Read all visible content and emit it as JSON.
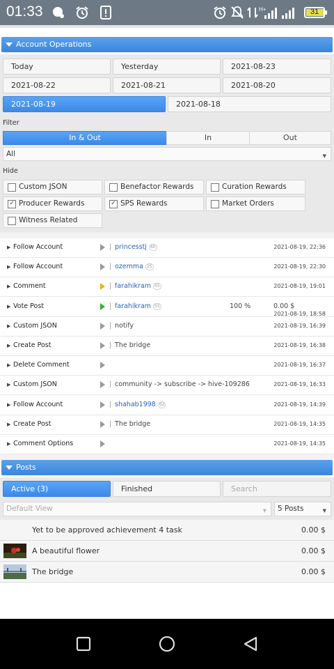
{
  "status_bar": {
    "time": "01:33",
    "battery": "31",
    "network": "H+"
  },
  "account_operations": {
    "header": "Account Operations",
    "date_buttons": [
      {
        "label": "Today",
        "active": false
      },
      {
        "label": "Yesterday",
        "active": false
      },
      {
        "label": "2021-08-23",
        "active": false
      },
      {
        "label": "2021-08-22",
        "active": false
      },
      {
        "label": "2021-08-21",
        "active": false
      },
      {
        "label": "2021-08-20",
        "active": false
      },
      {
        "label": "2021-08-19",
        "active": true
      },
      {
        "label": "2021-08-18",
        "active": false
      }
    ],
    "filter": {
      "label": "Filter",
      "segments": [
        {
          "label": "In & Out",
          "active": true
        },
        {
          "label": "In",
          "active": false
        },
        {
          "label": "Out",
          "active": false
        }
      ],
      "select_value": "All"
    },
    "hide": {
      "label": "Hide",
      "options": [
        {
          "label": "Custom JSON",
          "checked": false
        },
        {
          "label": "Benefactor Rewards",
          "checked": false
        },
        {
          "label": "Curation Rewards",
          "checked": false
        },
        {
          "label": "Producer Rewards",
          "checked": true
        },
        {
          "label": "SPS Rewards",
          "checked": true
        },
        {
          "label": "Market Orders",
          "checked": false
        },
        {
          "label": "Witness Related",
          "checked": false
        }
      ]
    },
    "operations": [
      {
        "name": "Follow Account",
        "detail": "princesstj",
        "rep": "60",
        "is_link": true,
        "time": "2021-08-19, 22:36",
        "play_color": "#9a9a9a"
      },
      {
        "name": "Follow Account",
        "detail": "ozemma",
        "rep": "25",
        "is_link": true,
        "time": "2021-08-19, 22:30",
        "play_color": "#9a9a9a"
      },
      {
        "name": "Comment",
        "detail": "farahikram",
        "rep": "55",
        "is_link": true,
        "time": "2021-08-19, 19:01",
        "play_color": "#e8b21c"
      },
      {
        "name": "Vote Post",
        "detail": "farahikram",
        "rep": "55",
        "is_link": true,
        "pct": "100 %",
        "amount": "0.00 $",
        "time": "2021-08-19, 18:58",
        "play_color": "#2fb52f"
      },
      {
        "name": "Custom JSON",
        "detail": "notify",
        "rep": "",
        "is_link": false,
        "time": "2021-08-19, 16:39",
        "play_color": "#9a9a9a"
      },
      {
        "name": "Create Post",
        "detail": "The bridge",
        "rep": "",
        "is_link": false,
        "time": "2021-08-19, 16:38",
        "play_color": "#9a9a9a"
      },
      {
        "name": "Delete Comment",
        "detail": "",
        "rep": "",
        "is_link": false,
        "time": "2021-08-19, 16:37",
        "play_color": "#9a9a9a"
      },
      {
        "name": "Custom JSON",
        "detail": "community -> subscribe -> hive-109286",
        "rep": "",
        "is_link": false,
        "time": "2021-08-19, 16:33",
        "play_color": "#9a9a9a"
      },
      {
        "name": "Follow Account",
        "detail": "shahab1998",
        "rep": "62",
        "is_link": true,
        "time": "2021-08-19, 14:39",
        "play_color": "#9a9a9a"
      },
      {
        "name": "Create Post",
        "detail": "The bridge",
        "rep": "",
        "is_link": false,
        "time": "2021-08-19, 14:35",
        "play_color": "#9a9a9a"
      },
      {
        "name": "Comment Options",
        "detail": "",
        "rep": "",
        "is_link": false,
        "time": "2021-08-19, 14:35",
        "play_color": "#9a9a9a"
      }
    ]
  },
  "posts": {
    "header": "Posts",
    "tabs": [
      {
        "label": "Active (3)",
        "active": true
      },
      {
        "label": "Finished",
        "active": false
      }
    ],
    "search_placeholder": "Search",
    "view_select": "Default View",
    "count_select": "5 Posts",
    "items": [
      {
        "title": "Yet to be approved achievement 4 task",
        "payout": "0.00 $",
        "thumb": "none"
      },
      {
        "title": "A beautiful flower",
        "payout": "0.00 $",
        "thumb": "flower"
      },
      {
        "title": "The bridge",
        "payout": "0.00 $",
        "thumb": "bridge"
      }
    ]
  },
  "nav_bar": {
    "buttons": [
      "recents-icon",
      "home-icon",
      "back-icon"
    ]
  }
}
